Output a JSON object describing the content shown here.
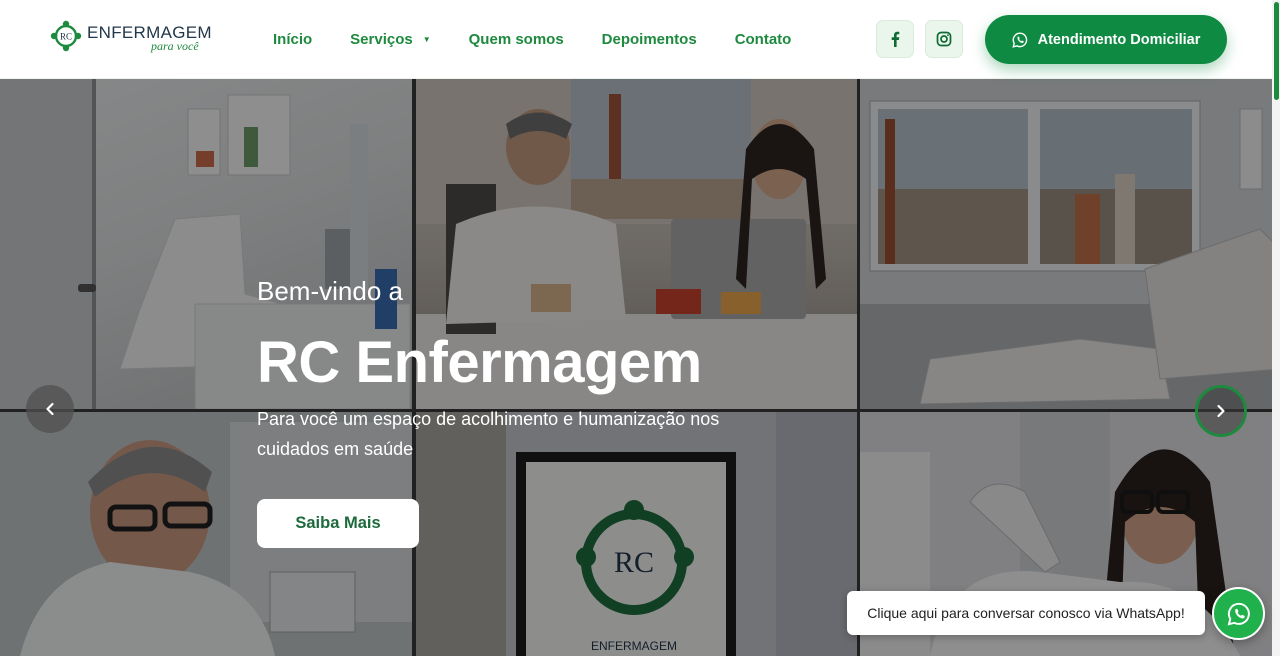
{
  "brand": {
    "logo_name": "ENFERMAGEM",
    "logo_mark_text": "RC",
    "logo_sub": "para você",
    "accent_color": "#1d8a3e",
    "cta_color": "#0f8a42"
  },
  "nav": {
    "items": [
      {
        "label": "Início"
      },
      {
        "label": "Serviços",
        "has_dropdown": true
      },
      {
        "label": "Quem somos"
      },
      {
        "label": "Depoimentos"
      },
      {
        "label": "Contato"
      }
    ]
  },
  "social": {
    "facebook_icon": "facebook-icon",
    "instagram_icon": "instagram-icon"
  },
  "header_cta": {
    "label": "Atendimento Domiciliar",
    "icon": "whatsapp-icon"
  },
  "hero": {
    "pre_title": "Bem-vindo a",
    "title": "RC Enfermagem",
    "description": "Para você um espaço de acolhimento e humanização nos cuidados em saúde",
    "button_label": "Saiba Mais",
    "prev_icon": "chevron-left-icon",
    "next_icon": "chevron-right-icon"
  },
  "whatsapp": {
    "tooltip": "Clique aqui para conversar conosco via WhatsApp!",
    "icon": "whatsapp-icon"
  }
}
